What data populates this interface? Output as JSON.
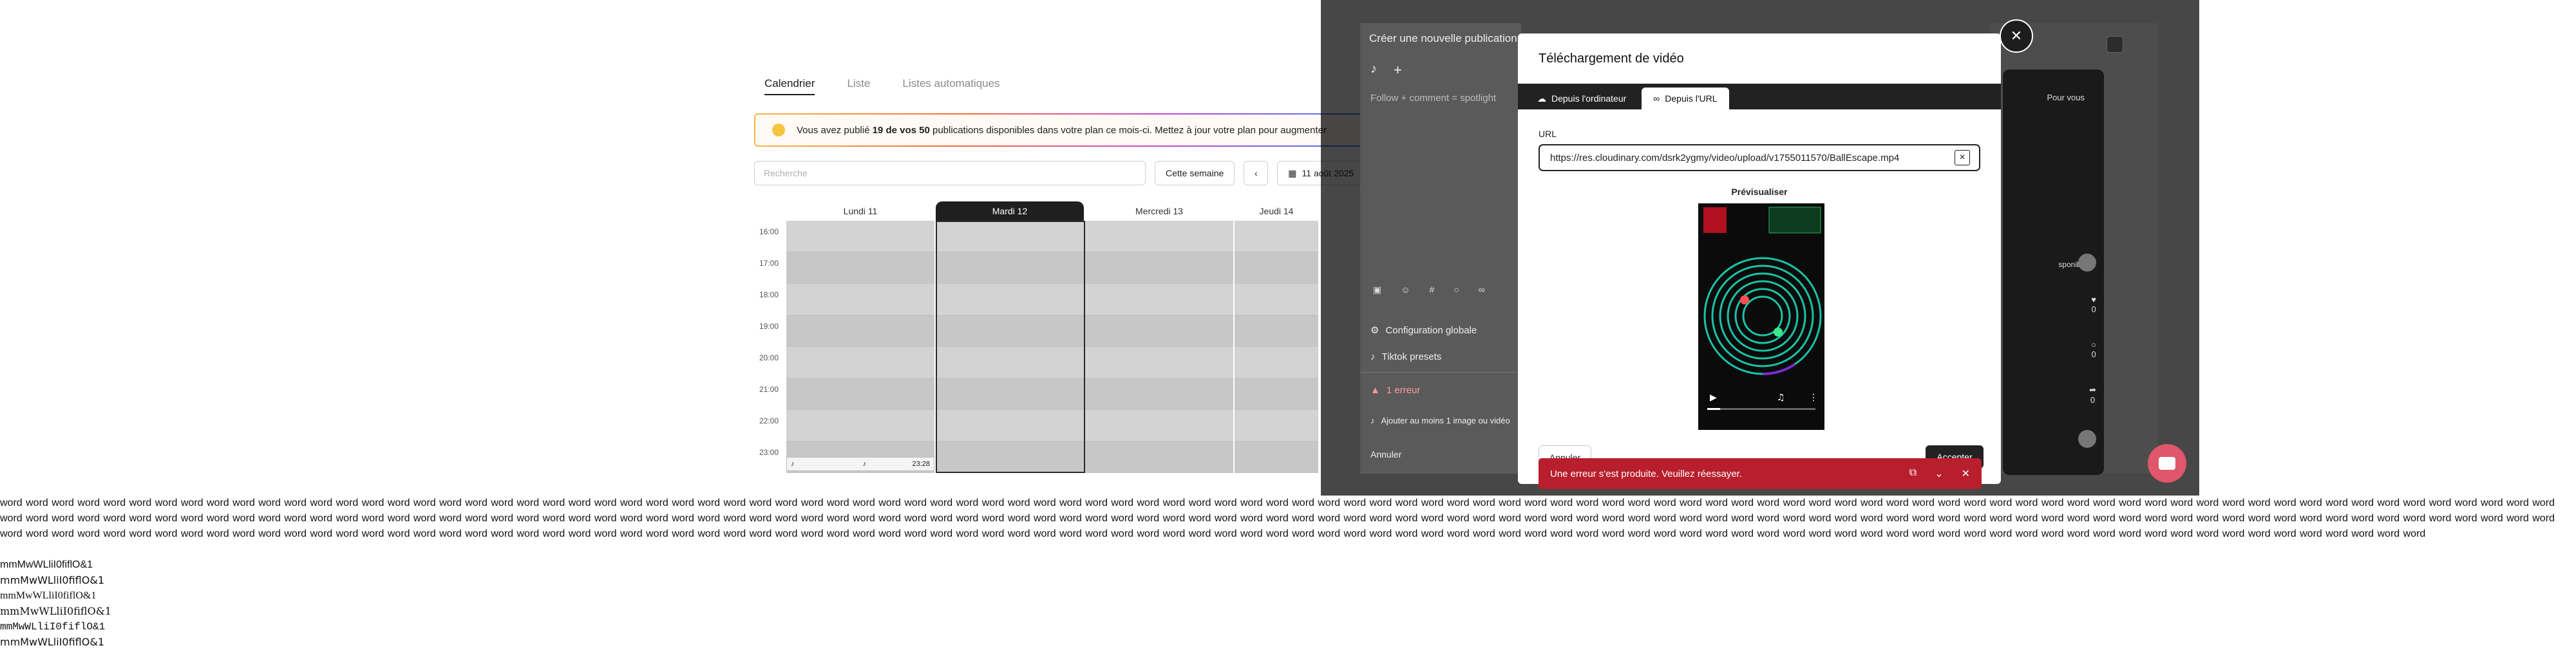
{
  "calendar": {
    "tabs": [
      "Calendrier",
      "Liste",
      "Listes automatiques"
    ],
    "active_tab": 0,
    "banner": {
      "prefix": "Vous avez publié ",
      "bold": "19 de vos 50",
      "suffix": " publications disponibles dans votre plan ce mois-ci. Mettez à jour votre plan pour augmenter"
    },
    "search_placeholder": "Recherche",
    "this_week_label": "Cette semaine",
    "date_label": "11 août 2025",
    "days": [
      "Lundi 11",
      "Mardi 12",
      "Mercredi 13",
      "Jeudi 14"
    ],
    "today_index": 1,
    "hours": [
      "16:00",
      "17:00",
      "18:00",
      "19:00",
      "20:00",
      "21:00",
      "22:00",
      "23:00"
    ],
    "event_time": "23:28"
  },
  "composer": {
    "title": "Créer une nouvelle publication",
    "description": "Follow + comment = spotlight",
    "global_config": "Configuration globale",
    "presets": "Tiktok presets",
    "errors": "1 erreur",
    "error_detail": "Ajouter au moins 1 image ou vidéo",
    "cancel": "Annuler"
  },
  "phone": {
    "for_you": "Pour vous",
    "unavailable": "sponible",
    "counts": [
      "0",
      "0",
      "0"
    ]
  },
  "modal": {
    "title": "Téléchargement de vidéo",
    "tabs": [
      "Depuis l'ordinateur",
      "Depuis l'URL"
    ],
    "active_tab": 1,
    "url_label": "URL",
    "url_value": "https://res.cloudinary.com/dsrk2ygmy/video/upload/v1755011570/BallEscape.mp4",
    "preview_label": "Prévisualiser",
    "cancel": "Annuler",
    "accept": "Accepter"
  },
  "toast": {
    "message": "Une erreur s'est produite. Veuillez réessayer."
  },
  "debug": {
    "words": "word word word word word word word word word word word word word word word word word word word word word word word word word word word word word word word word word word word word word word word word word word word word word word word word word word word word word word word word word word word word word word word word word word word word word word word word word word word word word word word word word word word word word word word word word word word word word word word word word word word word word word word word word word word word word word word word word word word word word word word word word word word word word word word word word word word word word word word word word word word word word word word word word word word word word word word word word word word word word word word word word word word word word word word word word word word word word word word word word word word word word word word word word word word word word word word word word word word word word word word word word word word word word word word word word word word word word word word word word word word word word word word word word word word word word word word word word word word word word word word word word word word word word word word word word word word word word word word word word word word word word word word word word word word word word word word word word word word word word word word word word word word word word word word word word word word word",
    "glyph_lines": [
      "mmMwWLliI0fiflO&1",
      "mmMwWLliI0fiflO&1",
      "mmMwWLliI0fiflO&1",
      "mmMwWLliI0fiflO&1",
      "mmMwWLliI0fiflO&1",
      "mmMwWLliI0fiflO&1"
    ]
  },
  "colors": {
    "toast": "#b81e2d",
    "fab": "#e0566a",
    "overlay": "rgba(0,0,0,0.72)"
  },
  "icons": [
    "tiktok-icon",
    "plus-icon",
    "upload-cloud-icon",
    "link-icon",
    "close-icon",
    "copy-icon",
    "chevron-down-icon",
    "chat-icon",
    "heart-icon",
    "comment-icon",
    "share-icon",
    "calendar-icon",
    "chevron-left-icon"
  ]
}
